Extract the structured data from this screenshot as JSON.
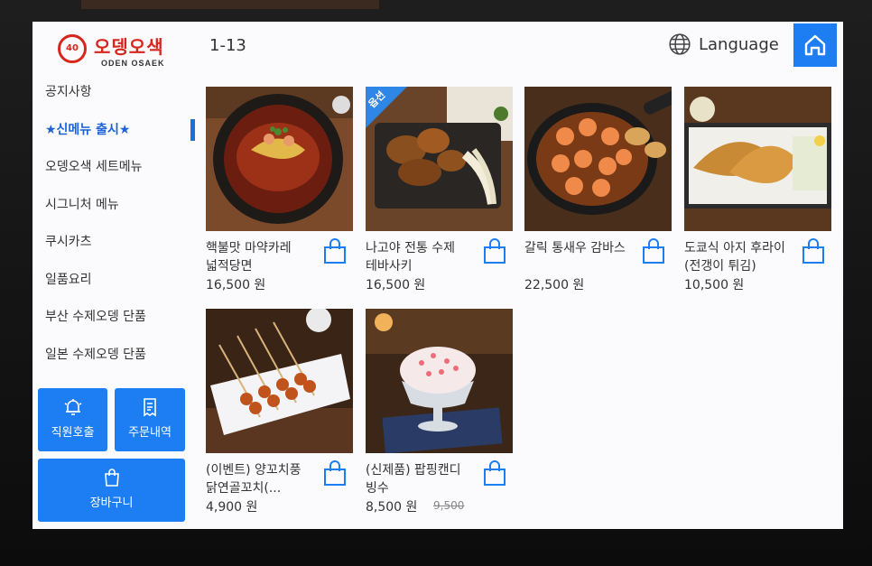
{
  "logo": {
    "title": "오뎅오색",
    "subtitle": "ODEN OSAEK",
    "mark": "40"
  },
  "header": {
    "item_count": "1-13",
    "language_label": "Language"
  },
  "sidebar": {
    "items": [
      {
        "label": "공지사항"
      },
      {
        "label": "★신메뉴 출시★",
        "active": true
      },
      {
        "label": "오뎅오색 세트메뉴"
      },
      {
        "label": "시그니처 메뉴"
      },
      {
        "label": "쿠시카츠"
      },
      {
        "label": "일품요리"
      },
      {
        "label": "부산 수제오뎅 단품"
      },
      {
        "label": "일본 수제오뎅 단품"
      }
    ],
    "buttons": {
      "staff_call": "직원호출",
      "order_history": "주문내역",
      "cart": "장바구니"
    }
  },
  "menu_items": [
    {
      "name": "핵불맛 마약카레 넓적당면",
      "price": "16,500 원"
    },
    {
      "name": "나고야 전통 수제 테바사키",
      "price": "16,500 원",
      "badge": "옵션"
    },
    {
      "name": "갈릭 통새우 감바스",
      "price": "22,500 원"
    },
    {
      "name": "도쿄식 아지 후라이(전갱이 튀김)",
      "price": "10,500 원"
    },
    {
      "name": "(이벤트) 양꼬치풍 닭연골꼬치(...",
      "price": "4,900 원"
    },
    {
      "name": "(신제품) 팝핑캔디 빙수",
      "price": "8,500 원",
      "original_price": "9,500"
    }
  ],
  "colors": {
    "accent": "#1d7ef4",
    "brand": "#d7261e",
    "active_menu": "#1d62d8"
  }
}
